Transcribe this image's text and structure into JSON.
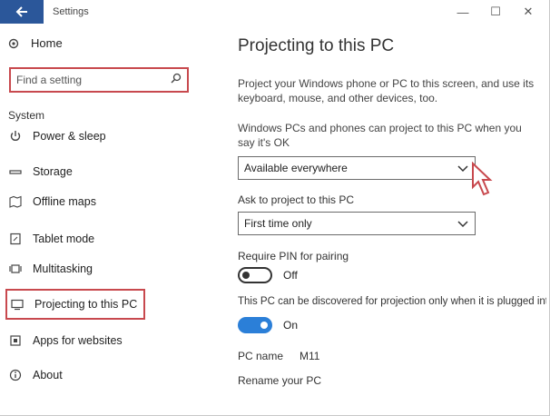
{
  "window": {
    "title": "Settings",
    "controls": {
      "minimize": "—",
      "maximize": "☐",
      "close": "✕"
    }
  },
  "sidebar": {
    "home_label": "Home",
    "search_placeholder": "Find a setting",
    "section_label": "System",
    "items": [
      {
        "label": "Power & sleep",
        "icon": "power-icon"
      },
      {
        "label": "Storage",
        "icon": "storage-icon"
      },
      {
        "label": "Offline maps",
        "icon": "map-icon"
      },
      {
        "label": "Tablet mode",
        "icon": "tablet-icon"
      },
      {
        "label": "Multitasking",
        "icon": "multitasking-icon"
      },
      {
        "label": "Projecting to this PC",
        "icon": "projecting-icon",
        "selected": true
      },
      {
        "label": "Apps for websites",
        "icon": "apps-websites-icon"
      },
      {
        "label": "About",
        "icon": "info-icon"
      }
    ]
  },
  "main": {
    "title": "Projecting to this PC",
    "description": "Project your Windows phone or PC to this screen, and use its keyboard, mouse, and other devices, too.",
    "description2": "Windows PCs and phones can project to this PC when you say it's OK",
    "availability_dropdown": {
      "value": "Available everywhere"
    },
    "ask_label": "Ask to project to this PC",
    "ask_dropdown": {
      "value": "First time only"
    },
    "pin_section_label": "Require PIN for pairing",
    "pin_toggle": {
      "state": "Off",
      "on": false
    },
    "plugged_label": "This PC can be discovered for projection only when it is plugged into a power source",
    "plugged_toggle": {
      "state": "On",
      "on": true
    },
    "pc_name_label": "PC name",
    "pc_name_value": "M11",
    "rename_link": "Rename your PC"
  },
  "colors": {
    "accent": "#2b579a",
    "highlight_border": "#c8494e",
    "toggle_on": "#2b7fd8"
  }
}
